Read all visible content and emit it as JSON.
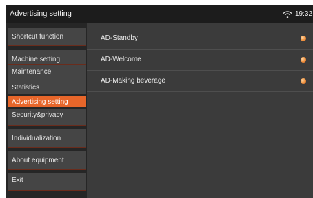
{
  "statusbar": {
    "title": "Advertising setting",
    "time": "19:32"
  },
  "sidebar": {
    "items": [
      {
        "label": "Shortcut function"
      },
      {
        "label": "Machine setting"
      },
      {
        "label": "Maintenance"
      },
      {
        "label": "Statistics"
      },
      {
        "label": "Advertising setting"
      },
      {
        "label": "Security&privacy"
      },
      {
        "label": "Individualization"
      },
      {
        "label": "About equipment"
      },
      {
        "label": "Exit"
      }
    ]
  },
  "main": {
    "rows": [
      {
        "label": "AD-Standby"
      },
      {
        "label": "AD-Welcome"
      },
      {
        "label": "AD-Making beverage"
      }
    ]
  },
  "colors": {
    "accent": "#e7662a",
    "background": "#3a3a3a",
    "statusbar": "#1c1c1c"
  },
  "icons": {
    "wifi": "wifi-icon",
    "toggle": "toggle-dot-icon"
  }
}
